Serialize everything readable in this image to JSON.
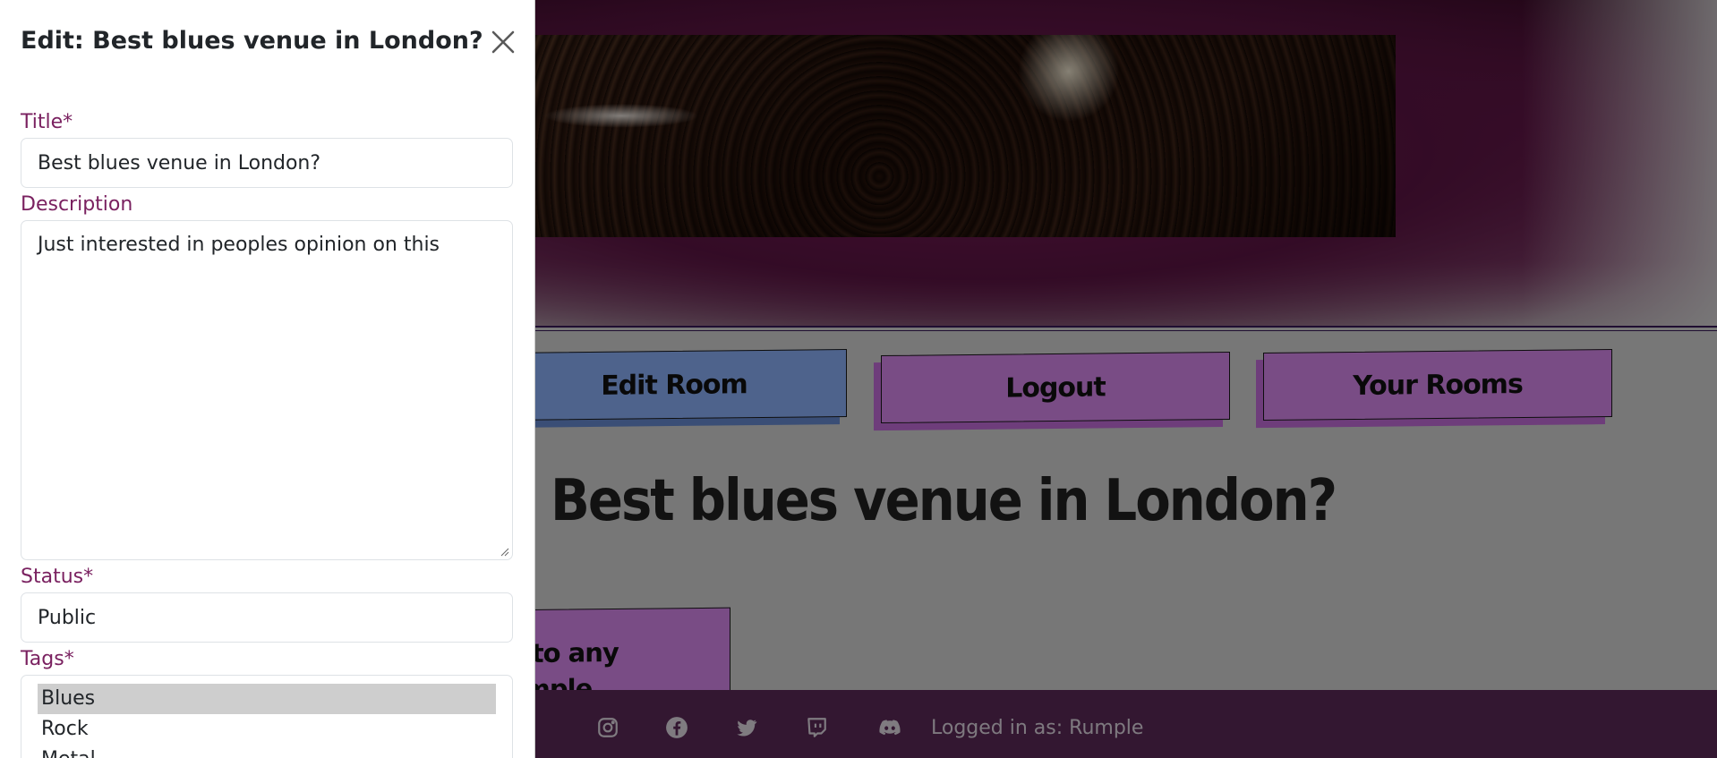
{
  "panel": {
    "title": "Edit: Best blues venue in London?",
    "title_label": "Title*",
    "title_value": "Best blues venue in London?",
    "description_label": "Description",
    "description_value": "Just interested in peoples opinion on this",
    "status_label": "Status*",
    "status_value": "Public",
    "tags_label": "Tags*",
    "tags_options": [
      "Blues",
      "Rock",
      "Metal"
    ],
    "tags_selected": "Blues"
  },
  "nav": {
    "edit_room": "Edit Room",
    "logout": "Logout",
    "your_rooms": "Your Rooms"
  },
  "room": {
    "heading": "Best blues venue in London?",
    "partial_button_line1": "n to any",
    "partial_button_line2": "umple"
  },
  "footer": {
    "icons": [
      "instagram-icon",
      "facebook-icon",
      "twitter-icon",
      "twitch-icon",
      "discord-icon"
    ],
    "logged_in": "Logged in as: Rumple"
  },
  "colors": {
    "label": "#7a2160",
    "nav_blue": "#8fb4ff",
    "nav_pink": "#dd8af2",
    "footer_bg": "#5d2a5a"
  }
}
